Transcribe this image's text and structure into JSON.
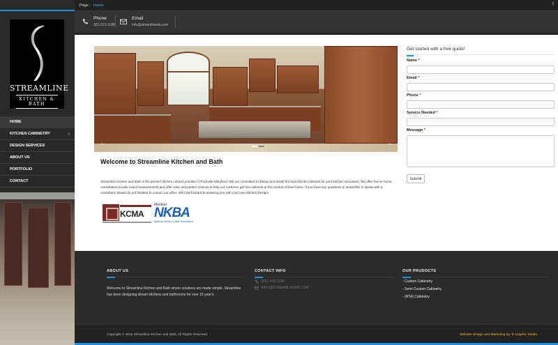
{
  "topbar": {
    "page_label": "Page :",
    "crumb": "Home",
    "facebook": "f"
  },
  "contact": {
    "phone_label": "Phone",
    "phone_value": "301-815-1188",
    "email_label": "Email",
    "email_value": "info@streamlinekb.com"
  },
  "logo": {
    "line1": "STREAMLINE",
    "line2": "KITCHEN & BATH"
  },
  "nav": {
    "items": [
      {
        "label": "Home"
      },
      {
        "label": "Kitchen Cabinetry",
        "expand": "+"
      },
      {
        "label": "Design Services"
      },
      {
        "label": "About Us"
      },
      {
        "label": "Portfolio"
      },
      {
        "label": "Contact"
      }
    ]
  },
  "slider": {
    "prev": "←",
    "next": "→"
  },
  "main": {
    "welcome_title": "Welcome to Streamline Kitchen and Bath",
    "intro": "Streamline Kitchen and Bath is the premier kitchen cabinet provider in Rockville Maryland. We are committed to design and install the best kitchen cabinets for your kitchen renovation. We offer free in-home consultation to take exact measurements and offer color and pattern choices to help our customer get fine cabinets at the comfort of their home. If you have any questions or would like to speak with a consultant, please do not hesitate to contact our office. We look forward to assisting you with your new Kitchen Design!",
    "kcma": "KCMA",
    "nkba_member": "Member",
    "nkba": "NKBA",
    "nkba_sub": "National Kitchen & Bath Association"
  },
  "form": {
    "title": "Get started with a free quote!",
    "name_label": "Name",
    "email_label": "Email",
    "phone_label": "Phone",
    "service_label": "Service Needed",
    "message_label": "Message",
    "required": "*",
    "submit": "Submit"
  },
  "footer": {
    "about_title": "ABOUT US",
    "about_text": "Welcome to Streamline Kitchen and Bath where solutions are made simple. Streamline has been designing dream kitchens and bathrooms for over 15 year's.",
    "contact_title": "CONTACT INFO",
    "contact_phone": "(301) 815-1188",
    "contact_email": "INFO@STREAMLINEKB.COM",
    "products_title": "OUR PRUDOCTS",
    "products": [
      "- Custom Cabinetry",
      "- Semi Custom Cabinetry",
      "- (RTA) Cabinetry"
    ],
    "copyright": "Copyright © 2015 Streamline Kitchen and Bath, All Rights Reserved",
    "credit": "Website Design and Marketing by: D Graphic Studio"
  },
  "colors": {
    "accent": "#1d8fd6",
    "credit": "#f0c020"
  }
}
